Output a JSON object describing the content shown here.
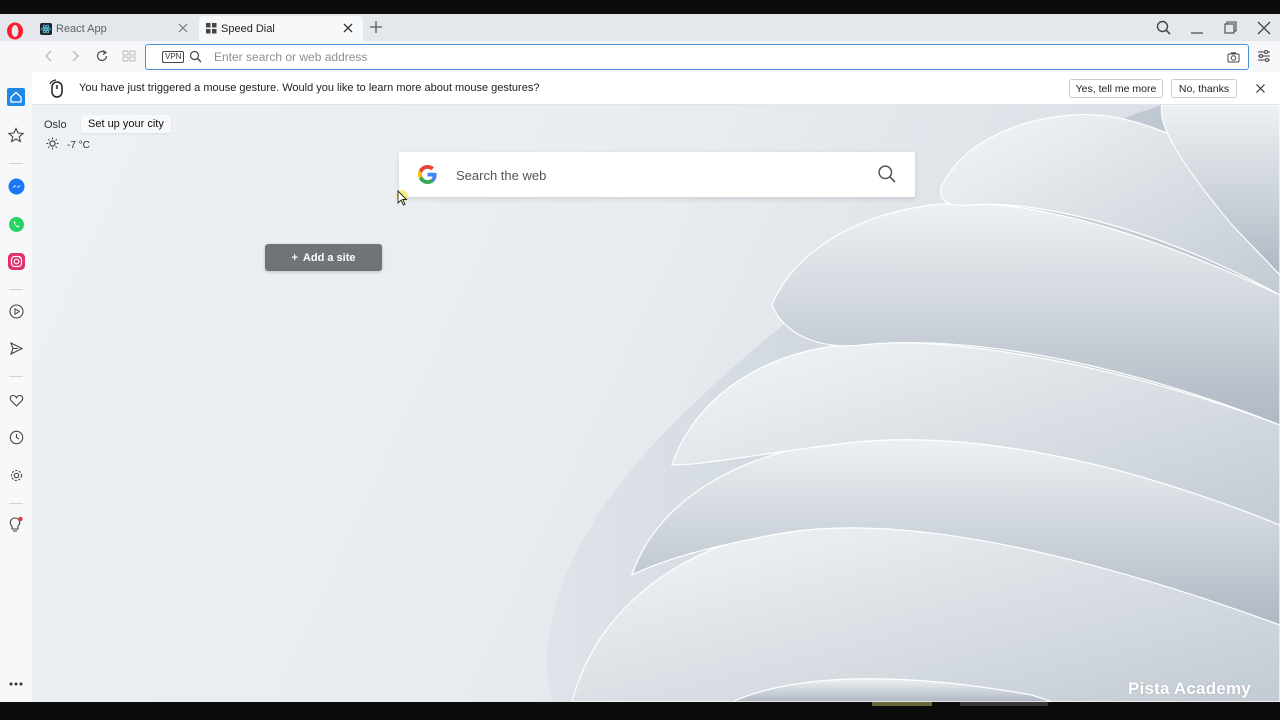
{
  "tabs": [
    {
      "title": "React App",
      "active": false
    },
    {
      "title": "Speed Dial",
      "active": true
    }
  ],
  "address_bar": {
    "vpn_label": "VPN",
    "placeholder": "Enter search or web address",
    "value": ""
  },
  "notification": {
    "message": "You have just triggered a mouse gesture. Would you like to learn more about mouse gestures?",
    "accept_label": "Yes, tell me more",
    "decline_label": "No, thanks"
  },
  "weather": {
    "city": "Oslo",
    "setup_label": "Set up your city",
    "temperature": "-7 °C"
  },
  "search": {
    "placeholder": "Search the web"
  },
  "speed_dial": {
    "add_site_label": "Add a site",
    "plus": "+"
  },
  "watermark": "Pista Academy",
  "sidebar_items": [
    "home",
    "bookmarks",
    "messenger",
    "whatsapp",
    "instagram",
    "player",
    "send",
    "my-flow-heart",
    "history",
    "settings",
    "tips",
    "more"
  ],
  "colors": {
    "accent": "#4a90d9",
    "opera_red": "#ff1b2d",
    "home_active": "#1e88e5",
    "messenger": "#1877f2",
    "whatsapp": "#25d366",
    "instagram": "#e1306c",
    "add_site_bg": "#6f7478"
  }
}
